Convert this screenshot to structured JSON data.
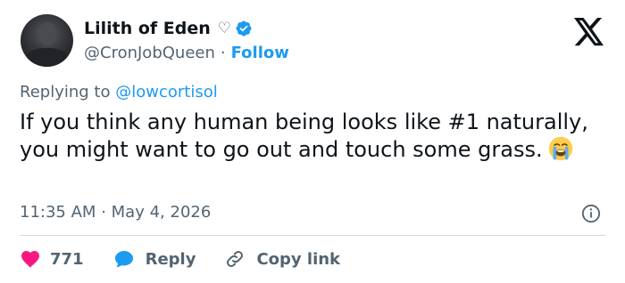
{
  "author": {
    "name": "Lilith of Eden",
    "name_suffix": "♡",
    "handle": "@CronJobQueen",
    "separator": "·",
    "follow_label": "Follow"
  },
  "tweet": {
    "reply_prefix": "Replying to",
    "reply_handle": "@lowcortisol",
    "text": "If you think any human being looks like #1 naturally, you might want to go out and touch some grass.",
    "time": "11:35 AM",
    "separator": "·",
    "date": "May 4, 2026"
  },
  "actions": {
    "like_count": "771",
    "reply_label": "Reply",
    "copy_link_label": "Copy link"
  },
  "icons": {
    "verified": "verified-badge-icon",
    "logo": "x-logo-icon",
    "info": "info-icon",
    "like": "heart-icon",
    "reply": "speech-bubble-icon",
    "copy": "link-icon",
    "emoji": "loudly-crying-face-emoji"
  },
  "colors": {
    "accent": "#1d9bf0",
    "like": "#f91880",
    "text": "#0f1419",
    "secondary": "#536471",
    "divider": "#cfd9de"
  }
}
